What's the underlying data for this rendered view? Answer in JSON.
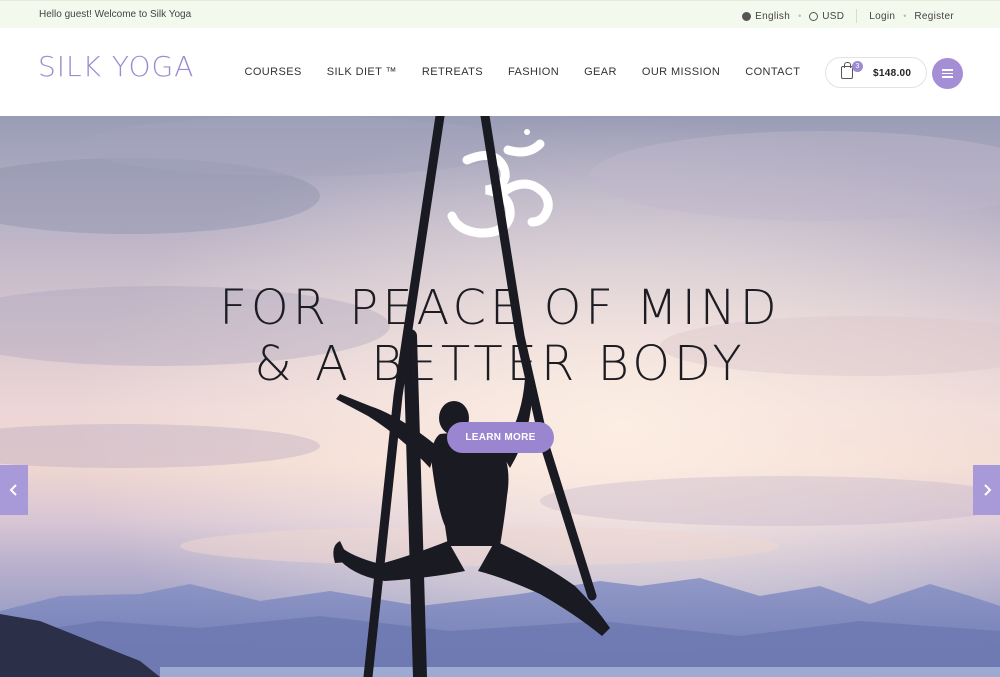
{
  "topbar": {
    "greeting": "Hello guest! Welcome to Silk Yoga",
    "language": "English",
    "currency": "USD",
    "login": "Login",
    "register": "Register"
  },
  "header": {
    "logo": "Silk Yoga",
    "nav": [
      "COURSES",
      "SILK DIET ™",
      "RETREATS",
      "FASHION",
      "GEAR",
      "OUR MISSION",
      "CONTACT"
    ],
    "cart_count": "3",
    "cart_total": "$148.00"
  },
  "hero": {
    "line1": "FOR PEACE OF MIND",
    "line2": "& A BETTER BODY",
    "cta": "LEARN MORE"
  },
  "colors": {
    "accent": "#9a85d1",
    "topbar_bg": "#f4f9ee",
    "logo": "#9c8bd0"
  },
  "icons": [
    "globe-icon",
    "currency-icon",
    "shopping-bag-icon",
    "hamburger-menu-icon",
    "om-symbol-icon",
    "chevron-left-icon",
    "chevron-right-icon"
  ]
}
